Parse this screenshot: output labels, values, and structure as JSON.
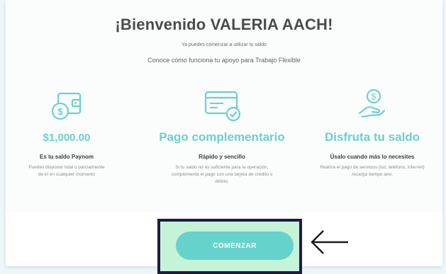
{
  "header": {
    "title": "¡Bienvenido VALERIA AACH!",
    "subtitle": "Ya puedes comenzar a utilizar tu saldo",
    "intro": "Conoce cómo funciona tu apoyo para Trabajo Flexible"
  },
  "features": [
    {
      "icon": "wallet-dollar-icon",
      "big": "$1,000.00",
      "heading": "Es tu saldo Paynom",
      "lines": [
        "Puedes disponer total o parcialmente",
        "de él en cualquier momento"
      ]
    },
    {
      "icon": "credit-card-check-icon",
      "big": "Pago complementario",
      "heading": "Rápido y sencillo",
      "lines": [
        "Si tu saldo no es suficiente para la operación,",
        "complementa el pago con una tarjeta de crédito o",
        "débito."
      ]
    },
    {
      "icon": "hand-coin-icon",
      "big": "Disfruta tu saldo",
      "heading": "Úsalo cuando más lo necesites",
      "lines": [
        "Realiza el pago de servicios (luz, teléfono, internet)",
        "recarga tiempo aire."
      ]
    }
  ],
  "cta": {
    "label": "COMENZAR"
  },
  "annotation": {
    "icon": "left-arrow-icon"
  },
  "colors": {
    "accent": "#6ccfd1",
    "button": "#66d2cc",
    "highlight": "#c5f3d8",
    "frame": "#1f1a44"
  }
}
